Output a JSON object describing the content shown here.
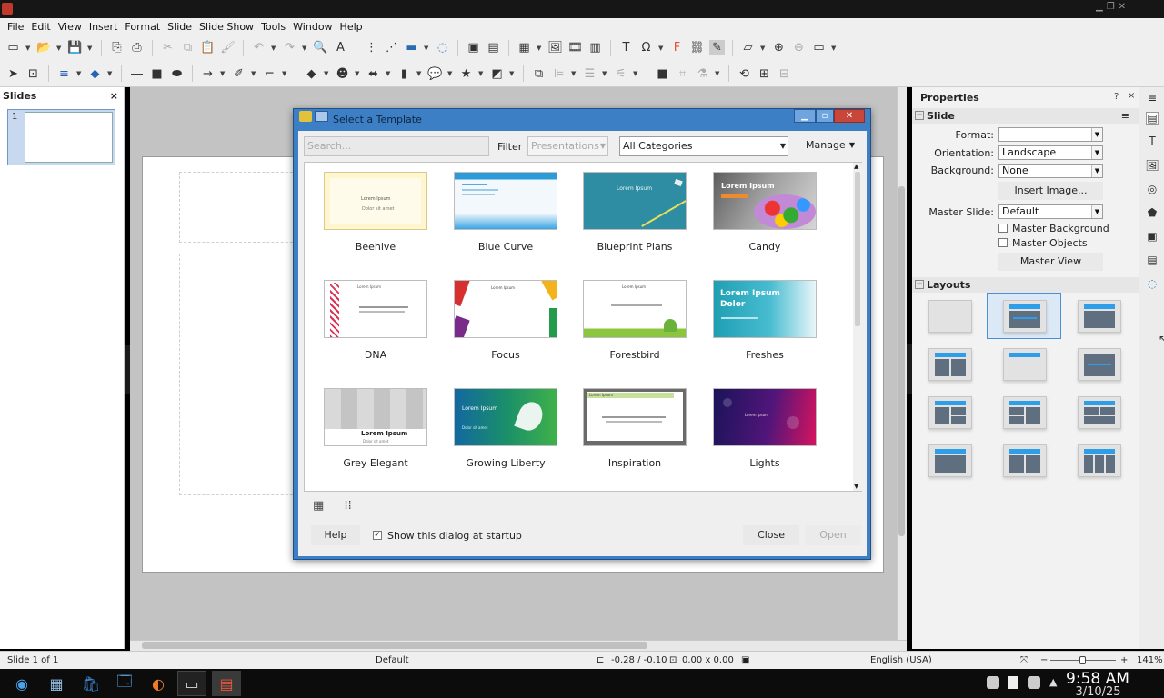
{
  "menubar": [
    "File",
    "Edit",
    "View",
    "Insert",
    "Format",
    "Slide",
    "Slide Show",
    "Tools",
    "Window",
    "Help"
  ],
  "slides_pane": {
    "title": "Slides",
    "close": "×",
    "slide_number": "1"
  },
  "dialog": {
    "title": "Select a Template",
    "search_placeholder": "Search...",
    "filter_label": "Filter",
    "filter_value": "Presentations",
    "category_value": "All Categories",
    "manage_label": "Manage",
    "help_label": "Help",
    "startup_label": "Show this dialog at startup",
    "startup_checked": true,
    "close_label": "Close",
    "open_label": "Open",
    "templates": [
      {
        "name": "Beehive",
        "text1": "Lorem Ipsum",
        "text2": "Dolor sit amet"
      },
      {
        "name": "Blue Curve",
        "text1": "",
        "text2": ""
      },
      {
        "name": "Blueprint Plans",
        "text1": "Lorem Ipsum",
        "text2": ""
      },
      {
        "name": "Candy",
        "text1": "Lorem Ipsum",
        "text2": ""
      },
      {
        "name": "DNA",
        "text1": "Lorem Ipsum",
        "text2": ""
      },
      {
        "name": "Focus",
        "text1": "Lorem Ipsum",
        "text2": ""
      },
      {
        "name": "Forestbird",
        "text1": "Lorem Ipsum",
        "text2": ""
      },
      {
        "name": "Freshes",
        "text1": "Lorem Ipsum Dolor",
        "text2": ""
      },
      {
        "name": "Grey Elegant",
        "text1": "Lorem Ipsum",
        "text2": "Dolor sit amet"
      },
      {
        "name": "Growing Liberty",
        "text1": "Lorem Ipsum",
        "text2": "Dolor sit amet"
      },
      {
        "name": "Inspiration",
        "text1": "Lorem Ipsum",
        "text2": ""
      },
      {
        "name": "Lights",
        "text1": "Lorem Ipsum",
        "text2": ""
      }
    ]
  },
  "properties": {
    "title": "Properties",
    "slide_section": "Slide",
    "format_label": "Format:",
    "format_value": "",
    "orientation_label": "Orientation:",
    "orientation_value": "Landscape",
    "background_label": "Background:",
    "background_value": "None",
    "insert_image": "Insert Image...",
    "master_slide_label": "Master Slide:",
    "master_slide_value": "Default",
    "master_background": "Master Background",
    "master_objects": "Master Objects",
    "master_view": "Master View",
    "layouts_section": "Layouts"
  },
  "statusbar": {
    "slide": "Slide 1 of 1",
    "master": "Default",
    "position": "-0.28 / -0.10",
    "size": "0.00 x 0.00",
    "language": "English (USA)",
    "zoom": "141%"
  },
  "taskbar": {
    "time": "9:58 AM",
    "date": "3/10/25"
  },
  "colors": {
    "dialog_frame": "#3c7fc4",
    "accent": "#2f9ee8"
  }
}
